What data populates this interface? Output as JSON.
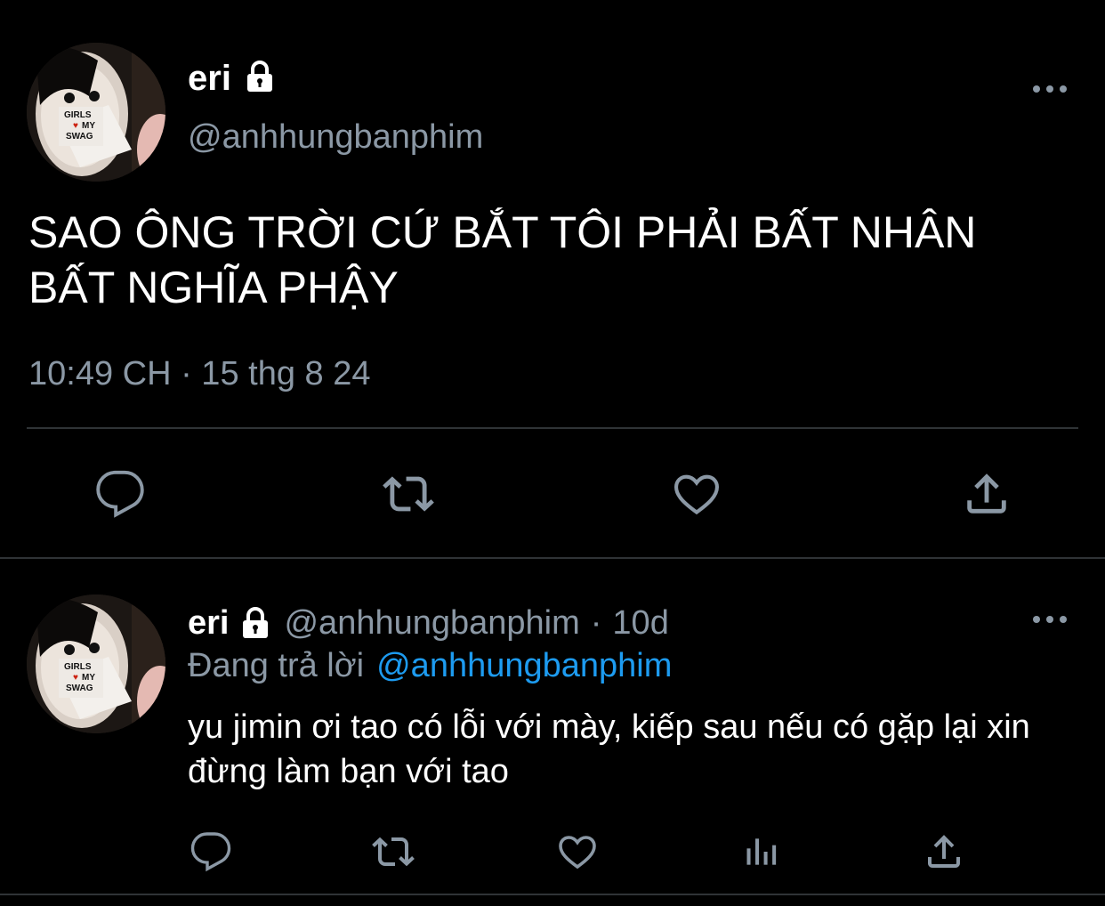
{
  "main_tweet": {
    "display_name": "eri",
    "lock_icon": "lock-icon",
    "handle": "@anhhungbanphim",
    "avatar_text": [
      "GIRLS",
      "MY",
      "SWAG"
    ],
    "text": "SAO ÔNG TRỜI CỨ BẮT TÔI PHẢI BẤT NHÂN BẤT NGHĨA PHẬY",
    "timestamp": "10:49 CH · 15 thg 8 24",
    "actions": [
      "reply-icon",
      "retweet-icon",
      "like-icon",
      "share-icon"
    ]
  },
  "reply_tweet": {
    "display_name": "eri",
    "handle": "@anhhungbanphim",
    "separator": "·",
    "age": "10d",
    "replying_label": "Đang trả lời",
    "replying_to": "@anhhungbanphim",
    "avatar_text": [
      "GIRLS",
      "MY",
      "SWAG"
    ],
    "text": "yu jimin ơi tao có lỗi với mày, kiếp sau nếu có gặp lại xin đừng làm bạn với tao",
    "actions": [
      "reply-icon",
      "retweet-icon",
      "like-icon",
      "analytics-icon",
      "share-icon"
    ]
  },
  "colors": {
    "background": "#000000",
    "text": "#ffffff",
    "muted": "#8b98a5",
    "link": "#1d9bf0",
    "divider": "#2f3336"
  }
}
